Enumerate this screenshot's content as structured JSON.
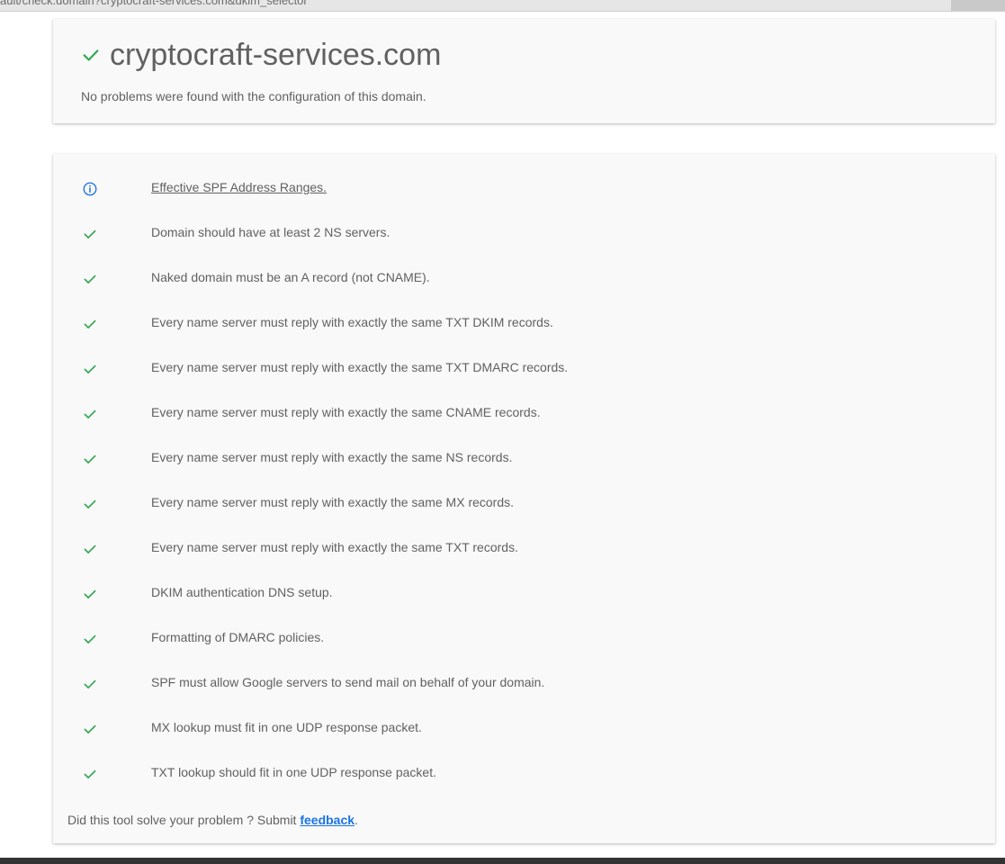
{
  "browser": {
    "url_text": "ault/check.domain?cryptocraft-services.com&dkim_selector"
  },
  "header": {
    "title": "cryptocraft-services.com",
    "subtitle": "No problems were found with the configuration of this domain."
  },
  "colors": {
    "check": "#34a853",
    "info": "#1a73e8",
    "link": "#1a73e8"
  },
  "results": [
    {
      "icon": "info-icon",
      "text": "Effective SPF Address Ranges.",
      "link": true
    },
    {
      "icon": "check-icon",
      "text": "Domain should have at least 2 NS servers."
    },
    {
      "icon": "check-icon",
      "text": "Naked domain must be an A record (not CNAME)."
    },
    {
      "icon": "check-icon",
      "text": "Every name server must reply with exactly the same TXT DKIM records."
    },
    {
      "icon": "check-icon",
      "text": "Every name server must reply with exactly the same TXT DMARC records."
    },
    {
      "icon": "check-icon",
      "text": "Every name server must reply with exactly the same CNAME records."
    },
    {
      "icon": "check-icon",
      "text": "Every name server must reply with exactly the same NS records."
    },
    {
      "icon": "check-icon",
      "text": "Every name server must reply with exactly the same MX records."
    },
    {
      "icon": "check-icon",
      "text": "Every name server must reply with exactly the same TXT records."
    },
    {
      "icon": "check-icon",
      "text": "DKIM authentication DNS setup."
    },
    {
      "icon": "check-icon",
      "text": "Formatting of DMARC policies."
    },
    {
      "icon": "check-icon",
      "text": "SPF must allow Google servers to send mail on behalf of your domain."
    },
    {
      "icon": "check-icon",
      "text": "MX lookup must fit in one UDP response packet."
    },
    {
      "icon": "check-icon",
      "text": "TXT lookup should fit in one UDP response packet."
    }
  ],
  "footer": {
    "prefix": "Did this tool solve your problem ? Submit ",
    "link_label": "feedback",
    "suffix": "."
  }
}
